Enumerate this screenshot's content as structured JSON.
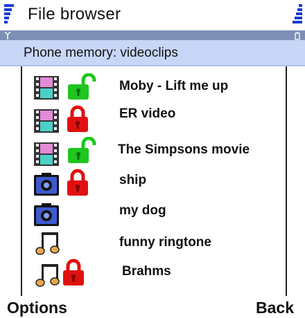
{
  "window": {
    "title": "File browser"
  },
  "location": {
    "text": "Phone memory: videoclips"
  },
  "files": [
    {
      "name": "Moby - Lift me up",
      "type": "video-icon",
      "lock": "unlocked"
    },
    {
      "name": "ER video",
      "type": "video-icon",
      "lock": "locked"
    },
    {
      "name": "The Simpsons movie",
      "type": "video-icon",
      "lock": "unlocked"
    },
    {
      "name": "ship",
      "type": "camera-icon",
      "lock": "locked"
    },
    {
      "name": "my dog",
      "type": "camera-icon",
      "lock": "none"
    },
    {
      "name": "funny ringtone",
      "type": "music-note-icon",
      "lock": "none"
    },
    {
      "name": "Brahms",
      "type": "music-note-icon",
      "lock": "locked"
    }
  ],
  "softkeys": {
    "left": "Options",
    "right": "Back"
  },
  "colors": {
    "header_bg": "#c8d6f7",
    "status_strip": "#7d8fb4",
    "signal_blue": "#1a3bd6",
    "lock_red": "#e01010",
    "unlock_green": "#1fc61f"
  }
}
